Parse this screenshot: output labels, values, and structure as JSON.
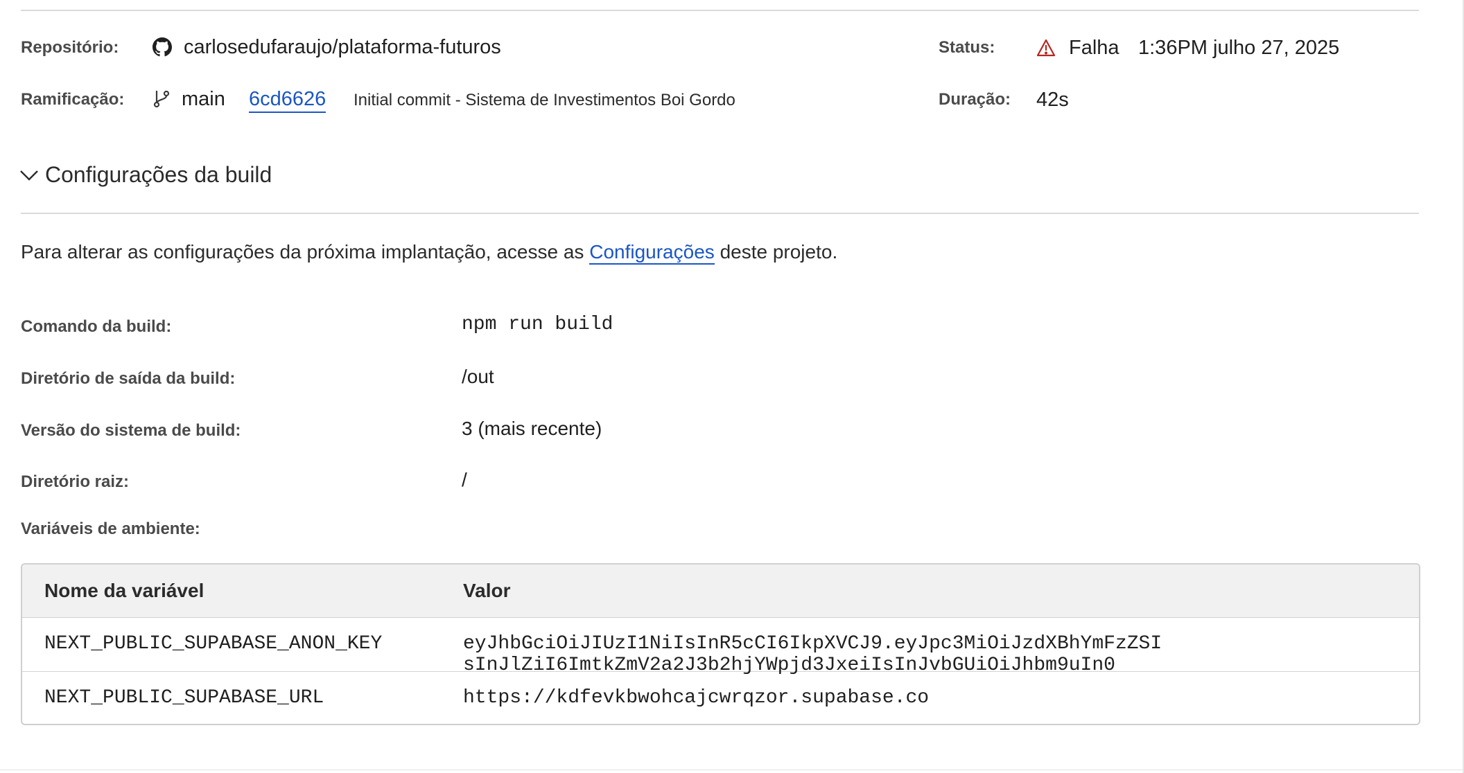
{
  "build_info": {
    "repository_label": "Repositório:",
    "repository_value": "carlosedufaraujo/plataforma-futuros",
    "branch_label": "Ramificação:",
    "branch_value": "main",
    "commit_hash": "6cd6626",
    "commit_message": "Initial commit - Sistema de Investimentos Boi Gordo",
    "status_label": "Status:",
    "status_value": "Falha",
    "status_timestamp": "1:36PM julho 27, 2025",
    "duration_label": "Duração:",
    "duration_value": "42s"
  },
  "build_settings": {
    "section_title": "Configurações da build",
    "intro_text_before": "Para alterar as configurações da próxima implantação, acesse as",
    "intro_link": "Configurações",
    "intro_text_after": "deste projeto.",
    "build_command_label": "Comando da build:",
    "build_command_value": "npm run build",
    "output_dir_label": "Diretório de saída da build:",
    "output_dir_value": "/out",
    "build_system_label": "Versão do sistema de build:",
    "build_system_value": "3 (mais recente)",
    "root_dir_label": "Diretório raiz:",
    "root_dir_value": "/",
    "env_vars_label": "Variáveis de ambiente:"
  },
  "env_table": {
    "headers": [
      "Nome da variável",
      "Valor"
    ],
    "rows": [
      {
        "name": "NEXT_PUBLIC_SUPABASE_ANON_KEY",
        "value": "eyJhbGciOiJIUzI1NiIsInR5cCI6IkpXVCJ9.eyJpc3MiOiJzdXBhYmFzZSI sInJlZiI6ImtkZmV2a2J3b2hjYWpjd3JxeiIsInJvbGUiOiJhbm9uIn0"
      },
      {
        "name": "NEXT_PUBLIC_SUPABASE_URL",
        "value": "https://kdfevkbwohcajcwrqzor.supabase.co"
      }
    ]
  },
  "colors": {
    "link": "#1a56c4",
    "status_failure": "#b3261e",
    "table_header_bg": "#f1f1f1"
  },
  "icons": {
    "repository": "github-icon",
    "branch": "git-branch-icon",
    "status": "warning-triangle-icon",
    "section_toggle": "chevron-down-icon"
  }
}
